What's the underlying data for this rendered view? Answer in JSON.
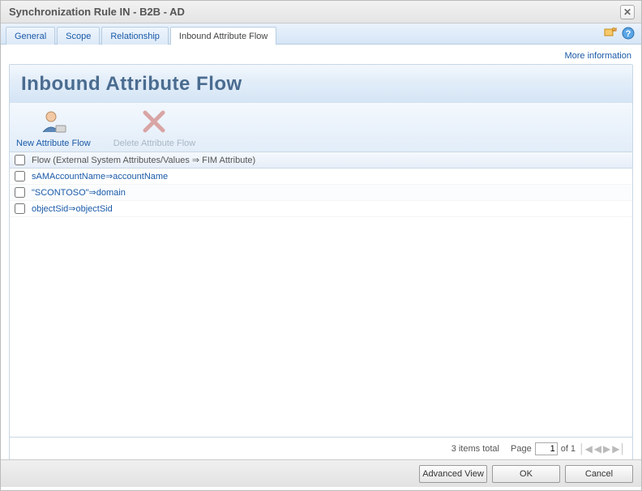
{
  "window": {
    "title": "Synchronization Rule IN - B2B - AD"
  },
  "tabs": {
    "general": "General",
    "scope": "Scope",
    "relationship": "Relationship",
    "inbound": "Inbound Attribute Flow"
  },
  "moreinfo": "More information",
  "panel": {
    "heading": "Inbound Attribute Flow"
  },
  "toolbar": {
    "new": "New Attribute Flow",
    "delete": "Delete Attribute Flow"
  },
  "grid": {
    "header": "Flow (External System Attributes/Values ⇒ FIM Attribute)",
    "rows": [
      {
        "text": "sAMAccountName⇒accountName"
      },
      {
        "text": "\"SCONTOSO\"⇒domain"
      },
      {
        "text": "objectSid⇒objectSid"
      }
    ],
    "totalText": "3 items total",
    "pageLabel": "Page",
    "pageValue": "1",
    "pageOf": "of 1"
  },
  "buttons": {
    "advanced": "Advanced View",
    "ok": "OK",
    "cancel": "Cancel"
  }
}
